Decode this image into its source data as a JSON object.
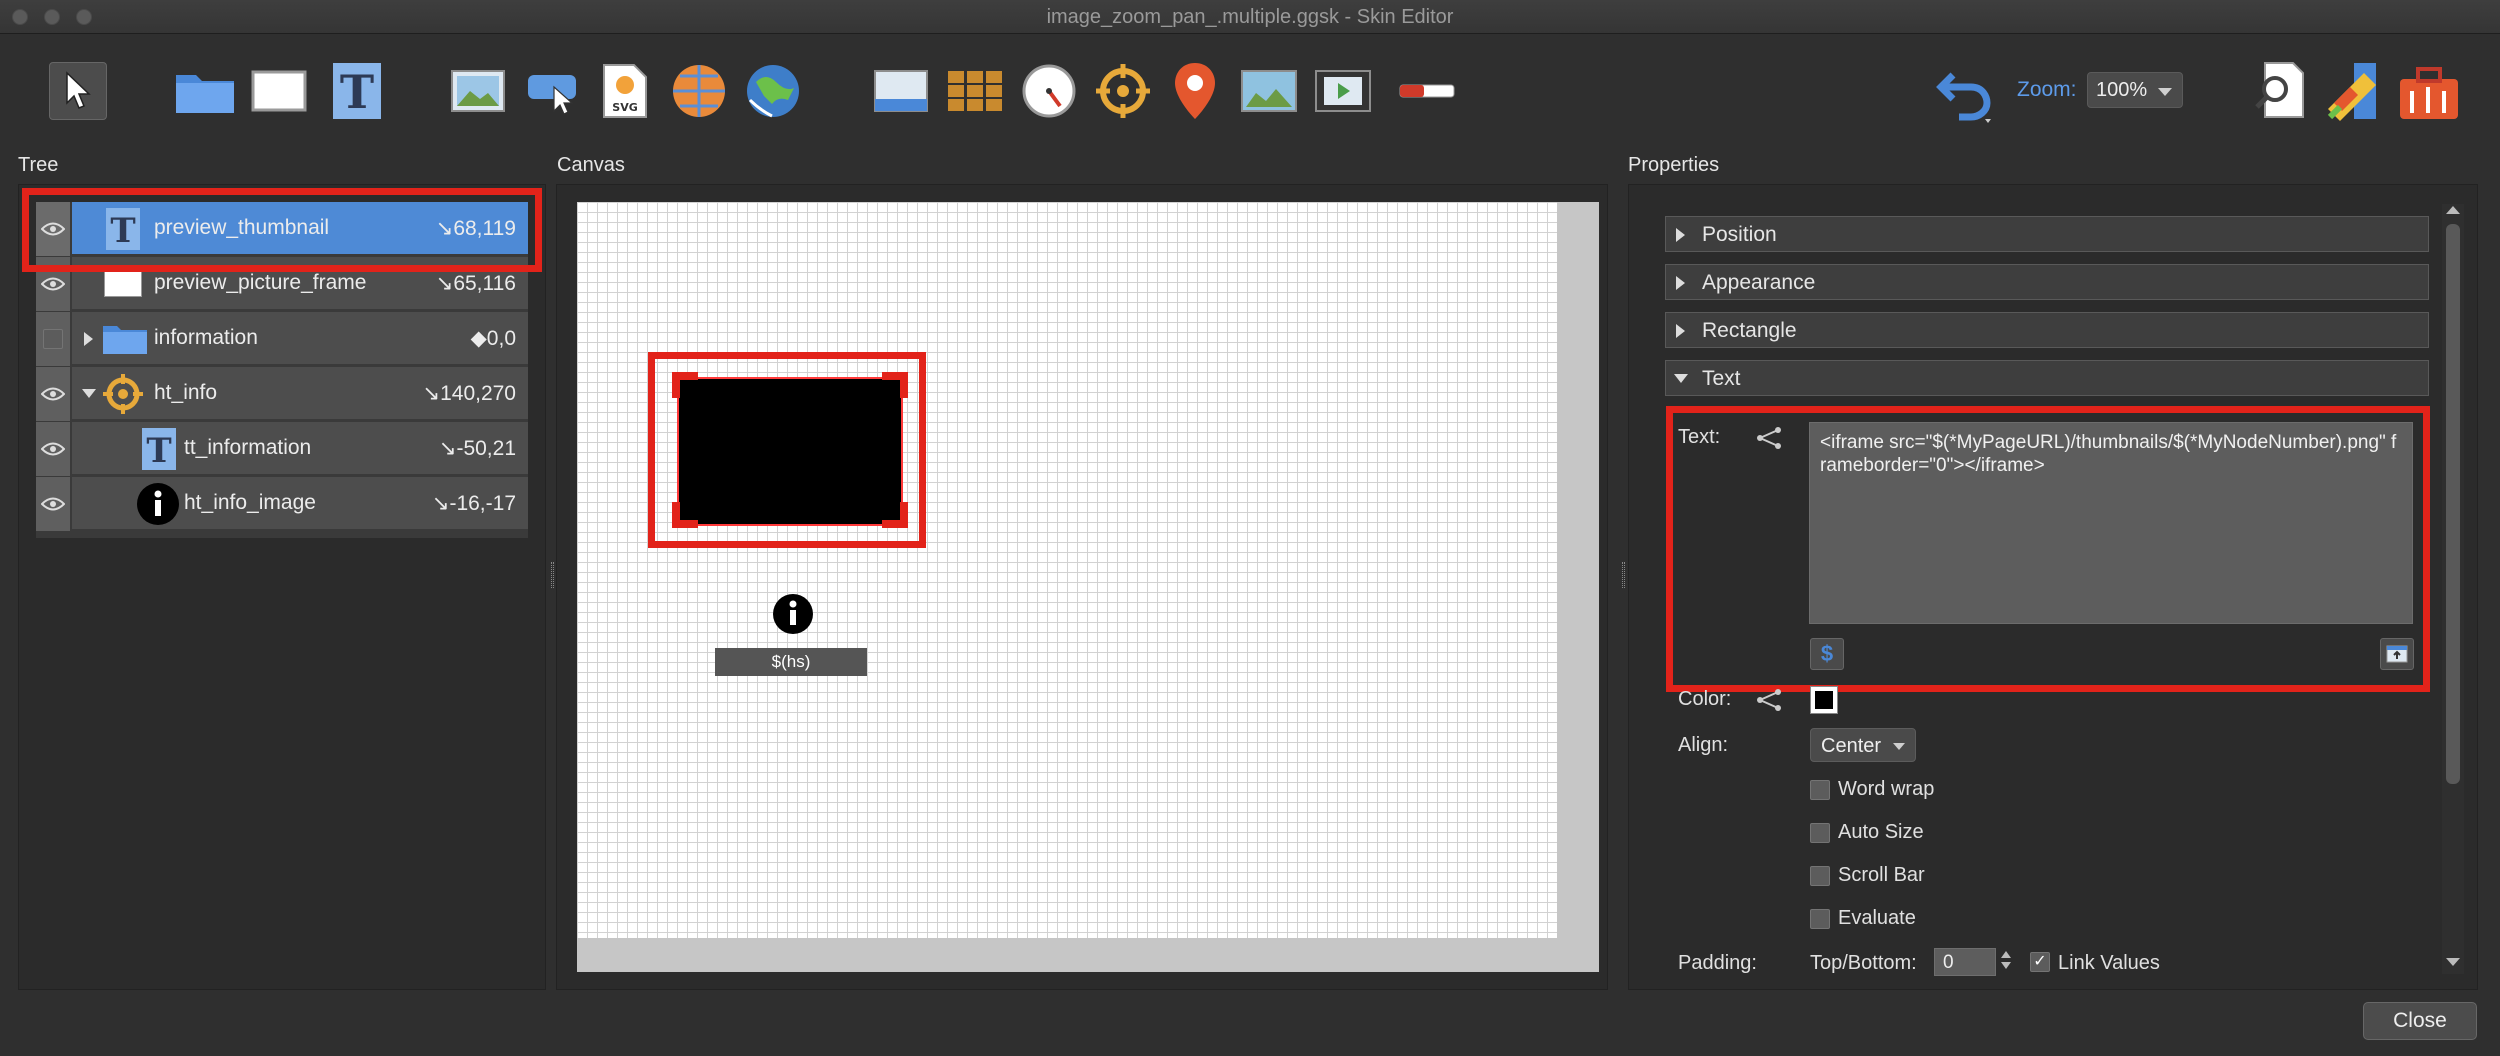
{
  "window": {
    "title": "image_zoom_pan_.multiple.ggsk - Skin Editor"
  },
  "toolbar": {
    "zoom_label": "Zoom:",
    "zoom_value": "100%"
  },
  "sections": {
    "tree": "Tree",
    "canvas": "Canvas",
    "properties": "Properties"
  },
  "tree": {
    "items": [
      {
        "label": "preview_thumbnail",
        "coord": "↘68,119",
        "icon": "text-icon",
        "selected": true
      },
      {
        "label": "preview_picture_frame",
        "coord": "↘65,116",
        "icon": "rectangle-icon"
      },
      {
        "label": "information",
        "coord": "◆0,0",
        "icon": "folder-icon"
      },
      {
        "label": "ht_info",
        "coord": "↘140,270",
        "icon": "hotspot-icon"
      },
      {
        "label": "tt_information",
        "coord": "↘-50,21",
        "icon": "text-icon"
      },
      {
        "label": "ht_info_image",
        "coord": "↘-16,-17",
        "icon": "info-icon"
      }
    ]
  },
  "canvas": {
    "hotspot_label": "$(hs)"
  },
  "properties": {
    "sections": [
      "Position",
      "Appearance",
      "Rectangle",
      "Text"
    ],
    "text_label": "Text:",
    "text_value": "<iframe src=\"$(*MyPageURL)/thumbnails/$(*MyNodeNumber).png\" frameborder=\"0\"></iframe>",
    "variable_button": "$",
    "color_label": "Color:",
    "align_label": "Align:",
    "align_value": "Center",
    "word_wrap": "Word wrap",
    "auto_size": "Auto Size",
    "scroll_bar": "Scroll Bar",
    "evaluate": "Evaluate",
    "padding_label": "Padding:",
    "top_bottom_label": "Top/Bottom:",
    "top_bottom_value": "0",
    "link_values": "Link Values"
  },
  "footer": {
    "close_label": "Close"
  },
  "colors": {
    "accent": "#4e8ad6",
    "highlight": "#e2231a",
    "zoom_label": "#5d9bea"
  }
}
